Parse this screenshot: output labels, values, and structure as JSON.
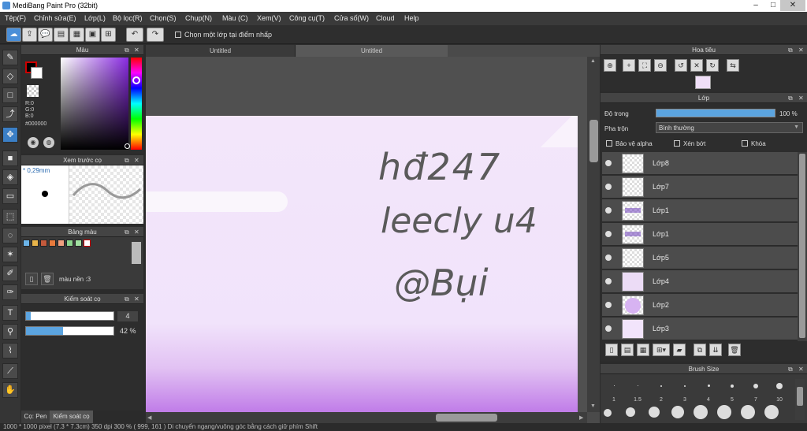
{
  "app": {
    "title": "MediBang Paint Pro (32bit)"
  },
  "window_buttons": [
    "–",
    "□",
    "✕"
  ],
  "menu": [
    "Tệp(F)",
    "Chỉnh sửa(E)",
    "Lớp(L)",
    "Bộ lọc(R)",
    "Chọn(S)",
    "Chụp(N)",
    "Màu (C)",
    "Xem(V)",
    "Công cụ(T)",
    "Cửa số(W)",
    "Cloud",
    "Help"
  ],
  "toolbar": {
    "checkbox_label": "Chọn một lớp tại điểm nhấp"
  },
  "tools": [
    "brush-icon",
    "eraser-icon",
    "rect-icon",
    "stroke-icon",
    "move-icon",
    "fill-rect-icon",
    "bucket-icon",
    "gradient-icon",
    "select-rect-icon",
    "lasso-icon",
    "magic-wand-icon",
    "select-pen-icon",
    "select-eraser-icon",
    "text-icon",
    "operation-icon",
    "blur-icon",
    "eyedropper-icon",
    "hand-icon"
  ],
  "color_panel": {
    "title": "Màu",
    "r": "R:0",
    "g": "G:0",
    "b": "B:0",
    "hex": "#000000",
    "primary_color": "#000000",
    "secondary_color": "#ffffff"
  },
  "brush_preview": {
    "title": "Xem trước cọ",
    "size": "* 0,29mm"
  },
  "palette": {
    "title": "Bảng màu",
    "label": "màu nền :3",
    "swatches": [
      "#6bb4e8",
      "#e8b44a",
      "#c45a3c",
      "#e87a3c",
      "#f0a080",
      "#8cd48c",
      "#a0e0a0",
      "#ffffff"
    ]
  },
  "brush_control": {
    "title": "Kiểm soát cọ",
    "size_value": "4",
    "size_fill": 0.05,
    "opacity_value": "42 %",
    "opacity_fill": 0.42
  },
  "bottom_tabs": [
    "Cọ: Pen",
    "Kiểm soát cọ"
  ],
  "doc_tabs": [
    "Untitled",
    "Untitled"
  ],
  "navigator": {
    "title": "Hoa tiêu"
  },
  "layers": {
    "title": "Lớp",
    "opacity_label": "Độ trong",
    "opacity_value": "100 %",
    "blend_label": "Pha trộn",
    "blend_value": "Bình thường",
    "protect_alpha": "Bảo vệ alpha",
    "clipping": "Xén bớt",
    "lock": "Khóa",
    "items": [
      {
        "name": "Lớp8"
      },
      {
        "name": "Lớp7"
      },
      {
        "name": "Lớp1"
      },
      {
        "name": "Lớp1"
      },
      {
        "name": "Lớp5"
      },
      {
        "name": "Lớp4"
      },
      {
        "name": "Lớp2"
      },
      {
        "name": "Lớp3"
      }
    ]
  },
  "brush_size": {
    "title": "Brush Size",
    "labels": [
      "1",
      "1.5",
      "2",
      "3",
      "4",
      "5",
      "7",
      "10"
    ]
  },
  "canvas_text": [
    "hđ247",
    "leecly u4",
    "@Bụi"
  ],
  "status": {
    "text": "1000 * 1000 pixel   (7.3 * 7.3cm)   350 dpi   300 %   ( 999, 161 )   Di chuyển ngang/vuông góc bằng cách giữ phím Shift"
  }
}
